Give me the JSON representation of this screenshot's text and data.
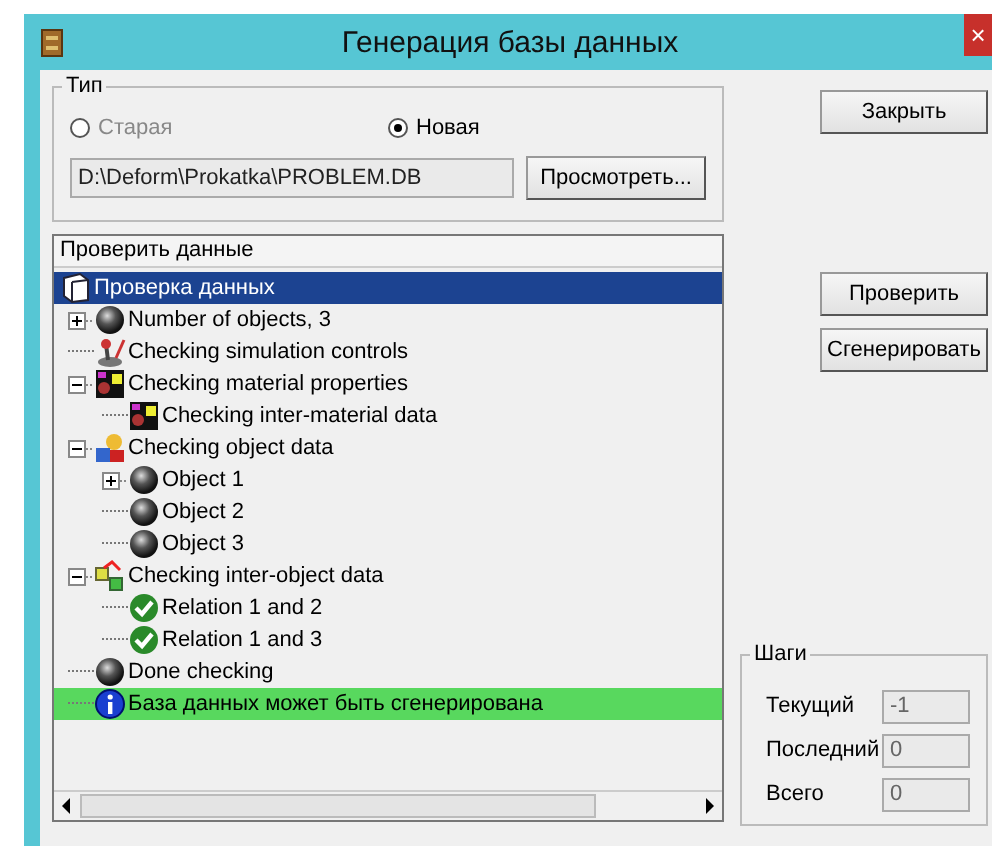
{
  "window": {
    "title": "Генерация базы данных",
    "close": "×"
  },
  "type_group": {
    "title": "Тип",
    "options": [
      {
        "label": "Старая",
        "selected": false,
        "disabled": true
      },
      {
        "label": "Новая",
        "selected": true,
        "disabled": false
      }
    ],
    "path": "D:\\Deform\\Prokatka\\PROBLEM.DB",
    "browse": "Просмотреть..."
  },
  "tree": {
    "header": "Проверить данные",
    "nodes": [
      {
        "label": "Проверка данных",
        "kind": "book",
        "selected": true,
        "highlighted": false,
        "children": [
          {
            "label": "Number of objects, 3",
            "kind": "sphere",
            "selected": false,
            "highlighted": false,
            "expanded": false
          },
          {
            "label": "Checking simulation controls",
            "kind": "joystick",
            "selected": false,
            "highlighted": false
          },
          {
            "label": "Checking material properties",
            "kind": "material",
            "selected": false,
            "highlighted": false,
            "expanded": true,
            "children": [
              {
                "label": "Checking inter-material data",
                "kind": "material",
                "selected": false,
                "highlighted": false
              }
            ]
          },
          {
            "label": "Checking object data",
            "kind": "objects",
            "selected": false,
            "highlighted": false,
            "expanded": true,
            "children": [
              {
                "label": "Object 1",
                "kind": "sphere",
                "selected": false,
                "highlighted": false,
                "expanded": false
              },
              {
                "label": "Object 2",
                "kind": "sphere",
                "selected": false,
                "highlighted": false
              },
              {
                "label": "Object 3",
                "kind": "sphere",
                "selected": false,
                "highlighted": false
              }
            ]
          },
          {
            "label": "Checking inter-object data",
            "kind": "relations",
            "selected": false,
            "highlighted": false,
            "expanded": true,
            "children": [
              {
                "label": "Relation 1 and 2",
                "kind": "check",
                "selected": false,
                "highlighted": false
              },
              {
                "label": "Relation 1 and 3",
                "kind": "check",
                "selected": false,
                "highlighted": false
              }
            ]
          },
          {
            "label": "Done checking",
            "kind": "sphere",
            "selected": false,
            "highlighted": false
          },
          {
            "label": "База данных может быть сгенерирована",
            "kind": "info",
            "selected": false,
            "highlighted": true
          }
        ]
      }
    ]
  },
  "buttons": {
    "close": "Закрыть",
    "check": "Проверить",
    "generate": "Сгенерировать"
  },
  "steps": {
    "title": "Шаги",
    "fields": [
      {
        "label": "Текущий",
        "value": "-1"
      },
      {
        "label": "Последний",
        "value": "0"
      },
      {
        "label": "Всего",
        "value": "0"
      }
    ]
  }
}
